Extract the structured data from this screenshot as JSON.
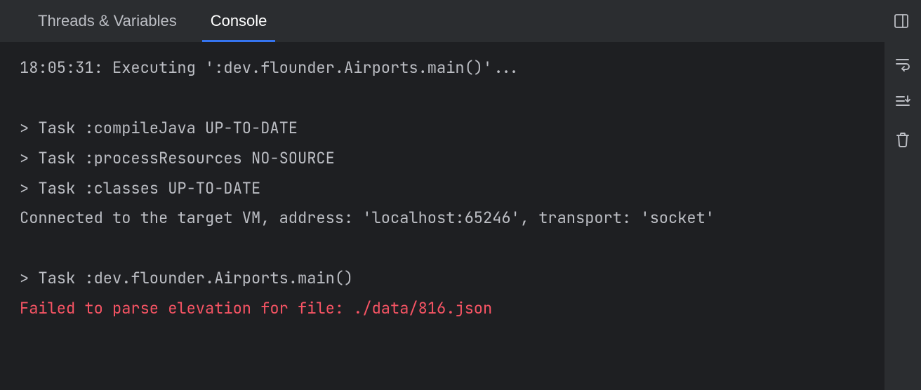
{
  "tabs": {
    "threads_variables": "Threads & Variables",
    "console": "Console"
  },
  "console": {
    "lines": [
      {
        "text": "18:05:31: Executing ':dev.flounder.Airports.main()'...",
        "type": "normal"
      },
      {
        "text": "",
        "type": "normal"
      },
      {
        "text": "> Task :compileJava UP-TO-DATE",
        "type": "normal"
      },
      {
        "text": "> Task :processResources NO-SOURCE",
        "type": "normal"
      },
      {
        "text": "> Task :classes UP-TO-DATE",
        "type": "normal"
      },
      {
        "text": "Connected to the target VM, address: 'localhost:65246', transport: 'socket'",
        "type": "normal"
      },
      {
        "text": "",
        "type": "normal"
      },
      {
        "text": "> Task :dev.flounder.Airports.main()",
        "type": "normal"
      },
      {
        "text": "Failed to parse elevation for file: ./data/816.json",
        "type": "error"
      }
    ]
  },
  "icons": {
    "layout": "layout-icon",
    "soft_wrap": "soft-wrap-icon",
    "scroll_to_end": "scroll-to-end-icon",
    "clear": "clear-icon"
  }
}
